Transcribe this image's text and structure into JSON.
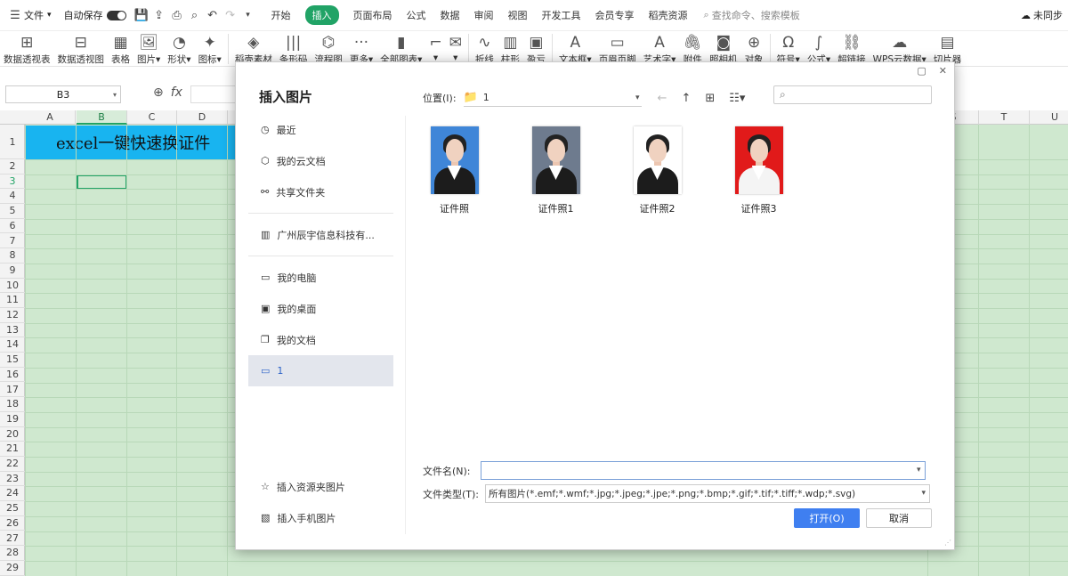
{
  "menubar": {
    "file_label": "文件",
    "autosave_label": "自动保存",
    "tabs": [
      "开始",
      "插入",
      "页面布局",
      "公式",
      "数据",
      "审阅",
      "视图",
      "开发工具",
      "会员专享",
      "稻壳资源"
    ],
    "active_tab": "插入",
    "search_placeholder": "查找命令、搜索模板",
    "sync_label": "未同步"
  },
  "ribbon": {
    "items": [
      "数据透视表",
      "数据透视图",
      "表格",
      "图片▾",
      "形状▾",
      "图标▾",
      "稻壳素材",
      "条形码",
      "流程图",
      "更多▾",
      "全部图表▾",
      "▾",
      "▾",
      "折线",
      "柱形",
      "盈亏",
      "文本框▾",
      "页眉页脚",
      "艺术字▾",
      "附件",
      "照相机",
      "对象",
      "符号▾",
      "公式▾",
      "超链接",
      "WPS云数据▾",
      "切片器"
    ]
  },
  "formula_bar": {
    "cell_ref": "B3",
    "fx_label": "fx"
  },
  "sheet": {
    "columns": [
      "A",
      "B",
      "C",
      "D",
      "S",
      "T",
      "U"
    ],
    "selected_column": "B",
    "rows": [
      "1",
      "2",
      "3",
      "4",
      "5",
      "6",
      "7",
      "8",
      "9",
      "10",
      "11",
      "12",
      "13",
      "14",
      "15",
      "16",
      "17",
      "18",
      "19",
      "20",
      "21",
      "22",
      "23",
      "24",
      "25",
      "26",
      "27",
      "28",
      "29"
    ],
    "selected_row": "3",
    "title_text": "excel一键快速换证件"
  },
  "dialog": {
    "title": "插入图片",
    "location_label": "位置(I):",
    "location_value": "1",
    "sidebar": [
      {
        "label": "最近",
        "icon": "clock-icon"
      },
      {
        "label": "我的云文档",
        "icon": "cloud-doc-icon"
      },
      {
        "label": "共享文件夹",
        "icon": "share-folder-icon"
      },
      {
        "label": "广州辰宇信息科技有...",
        "icon": "company-icon"
      },
      {
        "label": "我的电脑",
        "icon": "computer-icon"
      },
      {
        "label": "我的桌面",
        "icon": "desktop-icon"
      },
      {
        "label": "我的文档",
        "icon": "documents-icon"
      },
      {
        "label": "1",
        "icon": "folder-icon"
      }
    ],
    "sidebar_selected": "1",
    "sidebar_bottom": [
      {
        "label": "插入资源夹图片",
        "icon": "resource-folder-icon"
      },
      {
        "label": "插入手机图片",
        "icon": "phone-image-icon"
      }
    ],
    "files": [
      {
        "name": "证件照",
        "bg": "#3f86d8"
      },
      {
        "name": "证件照1",
        "bg": "#6e7b8e"
      },
      {
        "name": "证件照2",
        "bg": "#ffffff"
      },
      {
        "name": "证件照3",
        "bg": "#e11a1a"
      }
    ],
    "filename_label": "文件名(N):",
    "filename_value": "",
    "filetype_label": "文件类型(T):",
    "filetype_value": "所有图片(*.emf;*.wmf;*.jpg;*.jpeg;*.jpe;*.png;*.bmp;*.gif;*.tif;*.tiff;*.wdp;*.svg)",
    "open_label": "打开(O)",
    "cancel_label": "取消"
  },
  "colors": {
    "accent": "#21a366",
    "title_cell_bg": "#18b4f0",
    "grid_bg": "#cfe8cf",
    "open_button": "#3f7ff0"
  }
}
